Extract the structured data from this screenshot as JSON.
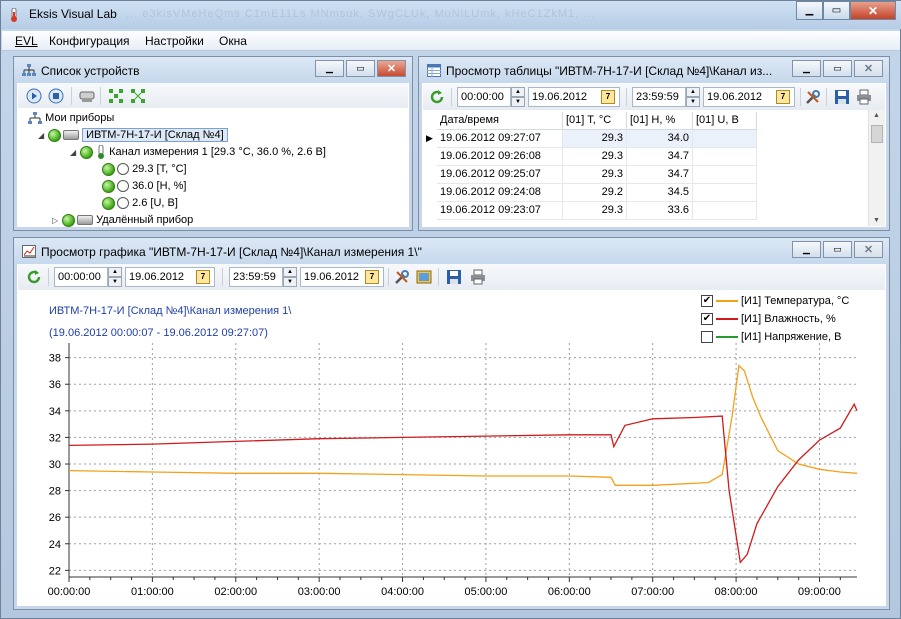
{
  "app": {
    "title": "Eksis Visual Lab",
    "title_ghost": "...  e3kisVMeHeQms  C1mE11Ls  MNmsuk,  SWgCLUk,  MuNiLUmk,  kHeC1ZkM1,  ..."
  },
  "menu": [
    "EVL",
    "Конфигурация",
    "Настройки",
    "Окна"
  ],
  "devices": {
    "title": "Список устройств",
    "root": "Мои приборы",
    "device": "ИВТМ-7Н-17-И [Склад №4]",
    "channel": "Канал измерения 1 [29.3 °C, 36.0 %, 2.6 В]",
    "params": [
      "29.3 [T, °C]",
      "36.0 [H, %]",
      "2.6 [U, В]"
    ],
    "remote": "Удалённый прибор"
  },
  "table": {
    "title": "Просмотр таблицы \"ИВТМ-7Н-17-И [Склад №4]\\Канал из...",
    "time_from": "00:00:00",
    "date_from": "19.06.2012",
    "time_to": "23:59:59",
    "date_to": "19.06.2012",
    "columns": [
      "Дата/время",
      "[01] T, °C",
      "[01] H, %",
      "[01] U, В"
    ],
    "rows": [
      [
        "19.06.2012 09:27:07",
        "29.3",
        "34.0",
        ""
      ],
      [
        "19.06.2012 09:26:08",
        "29.3",
        "34.7",
        ""
      ],
      [
        "19.06.2012 09:25:07",
        "29.3",
        "34.7",
        ""
      ],
      [
        "19.06.2012 09:24:08",
        "29.2",
        "34.5",
        ""
      ],
      [
        "19.06.2012 09:23:07",
        "29.3",
        "33.6",
        ""
      ]
    ]
  },
  "graph": {
    "title": "Просмотр графика \"ИВТМ-7Н-17-И [Склад №4]\\Канал измерения 1\\\"",
    "time_from": "00:00:00",
    "date_from": "19.06.2012",
    "time_to": "23:59:59",
    "date_to": "19.06.2012",
    "caption1": "ИВТМ-7Н-17-И [Склад №4]\\Канал измерения 1\\",
    "caption2": "(19.06.2012 00:00:07 - 19.06.2012 09:27:07)",
    "legend": [
      {
        "label": "[И1] Температура, °C",
        "checked": true,
        "color": "#f5a01a"
      },
      {
        "label": "[И1] Влажность, %",
        "checked": true,
        "color": "#d11a1a"
      },
      {
        "label": "[И1] Напряжение, В",
        "checked": false,
        "color": "#2a9a2a"
      }
    ],
    "check_mark": "✔"
  },
  "chart_data": {
    "type": "line",
    "x_ticks": [
      "00:00:00",
      "01:00:00",
      "02:00:00",
      "03:00:00",
      "04:00:00",
      "05:00:00",
      "06:00:00",
      "07:00:00",
      "08:00:00",
      "09:00:00"
    ],
    "y_ticks": [
      "38",
      "36",
      "34",
      "32",
      "30",
      "28",
      "26",
      "24",
      "22"
    ],
    "ylim": [
      21.5,
      38.5
    ],
    "grid": true,
    "legend_position": "top-right",
    "series": [
      {
        "name": "[И1] Температура, °C",
        "color": "#f5a01a",
        "x": [
          "00:00",
          "01:00",
          "02:00",
          "03:00",
          "04:00",
          "05:00",
          "06:00",
          "06:30",
          "06:33",
          "07:00",
          "07:40",
          "07:50",
          "07:57",
          "08:02",
          "08:06",
          "08:12",
          "08:18",
          "08:30",
          "08:45",
          "09:00",
          "09:15",
          "09:27"
        ],
        "y": [
          29.5,
          29.4,
          29.3,
          29.3,
          29.2,
          29.1,
          29.1,
          29.0,
          28.4,
          28.4,
          28.6,
          29.2,
          33.5,
          37.4,
          37.0,
          35.0,
          33.5,
          31.0,
          30.0,
          29.6,
          29.4,
          29.3
        ]
      },
      {
        "name": "[И1] Влажность, %",
        "color": "#d11a1a",
        "x": [
          "00:00",
          "01:00",
          "02:00",
          "03:00",
          "04:00",
          "05:00",
          "06:00",
          "06:30",
          "06:32",
          "06:40",
          "07:00",
          "07:30",
          "07:50",
          "07:55",
          "08:03",
          "08:08",
          "08:15",
          "08:30",
          "08:45",
          "09:00",
          "09:15",
          "09:25",
          "09:27"
        ],
        "y": [
          31.4,
          31.5,
          31.7,
          31.9,
          32.0,
          32.1,
          32.2,
          32.2,
          31.3,
          32.9,
          33.4,
          33.5,
          33.6,
          28.0,
          22.6,
          23.2,
          25.5,
          28.3,
          30.3,
          31.8,
          32.7,
          34.5,
          34.0
        ]
      }
    ]
  }
}
